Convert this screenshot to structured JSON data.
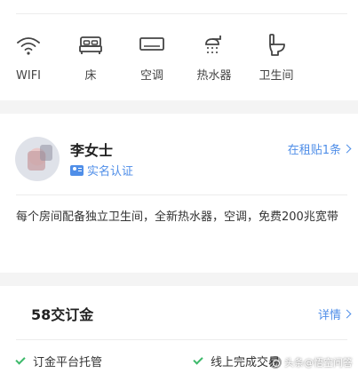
{
  "amenities": [
    {
      "label": "WIFI",
      "icon": "wifi-icon"
    },
    {
      "label": "床",
      "icon": "bed-icon"
    },
    {
      "label": "空调",
      "icon": "air-conditioner-icon"
    },
    {
      "label": "热水器",
      "icon": "water-heater-icon"
    },
    {
      "label": "卫生间",
      "icon": "toilet-icon"
    }
  ],
  "host": {
    "name": "李女士",
    "verified_label": "实名认证",
    "listings_link": "在租贴1条",
    "description": "每个房间配备独立卫生间，全新热水器，空调，免费200兆宽带"
  },
  "deposit": {
    "title": "58交订金",
    "details_link": "详情",
    "features": [
      "订金平台托管",
      "线上完成交易"
    ]
  },
  "watermark": "头条@悟空问答",
  "colors": {
    "accent": "#4f8ee8",
    "check": "#3cb96a",
    "background": "#f4f4f4"
  }
}
